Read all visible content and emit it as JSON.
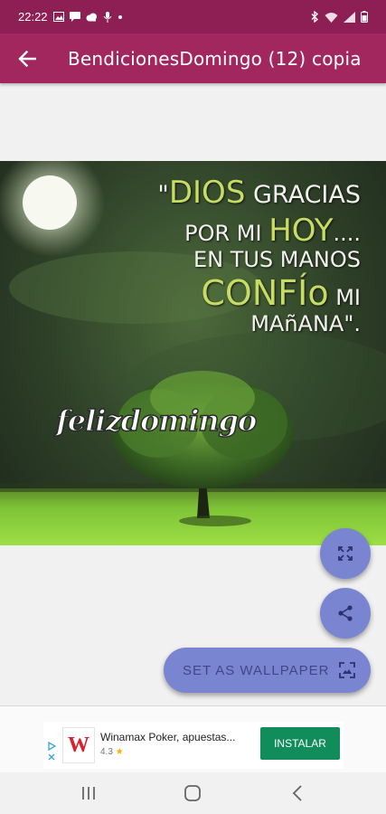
{
  "status_bar": {
    "time": "22:22",
    "left_icons": [
      "image-icon",
      "message-icon",
      "cloud-icon",
      "mic-off-icon",
      "dot-icon"
    ],
    "right_icons": [
      "bluetooth-icon",
      "wifi-icon",
      "signal-icon",
      "battery-icon"
    ]
  },
  "app_bar": {
    "title": "BendicionesDomingo (12) copia",
    "back_icon": "arrow-left-icon"
  },
  "wallpaper": {
    "quote": {
      "line1_small_a": "\"",
      "line1_big": "DIOS",
      "line1_small_b": " GRACIAS",
      "line2_small_a": "POR MI ",
      "line2_big": "HOY",
      "line2_small_b": "....",
      "line3": "EN TUS MANOS",
      "line4_big": "CONFÍo",
      "line4_small": " MI",
      "line5": "MAñANA\"."
    },
    "overlay_text": "felizdomingo"
  },
  "actions": {
    "expand_icon": "fullscreen-icon",
    "share_icon": "share-icon",
    "set_wallpaper_label": "SET AS WALLPAPER",
    "set_wallpaper_icon": "wallpaper-icon"
  },
  "ad": {
    "title": "Winamax Poker, apuestas...",
    "rating": "4.3",
    "install_label": "INSTALAR",
    "logo_letter": "W"
  },
  "nav_bar": {
    "icons": [
      "recents-icon",
      "home-icon",
      "back-icon"
    ]
  },
  "colors": {
    "status_bar": "#8e1f55",
    "app_bar": "#a3275f",
    "fab": "#7a85d2",
    "install_button": "#118d5c"
  }
}
